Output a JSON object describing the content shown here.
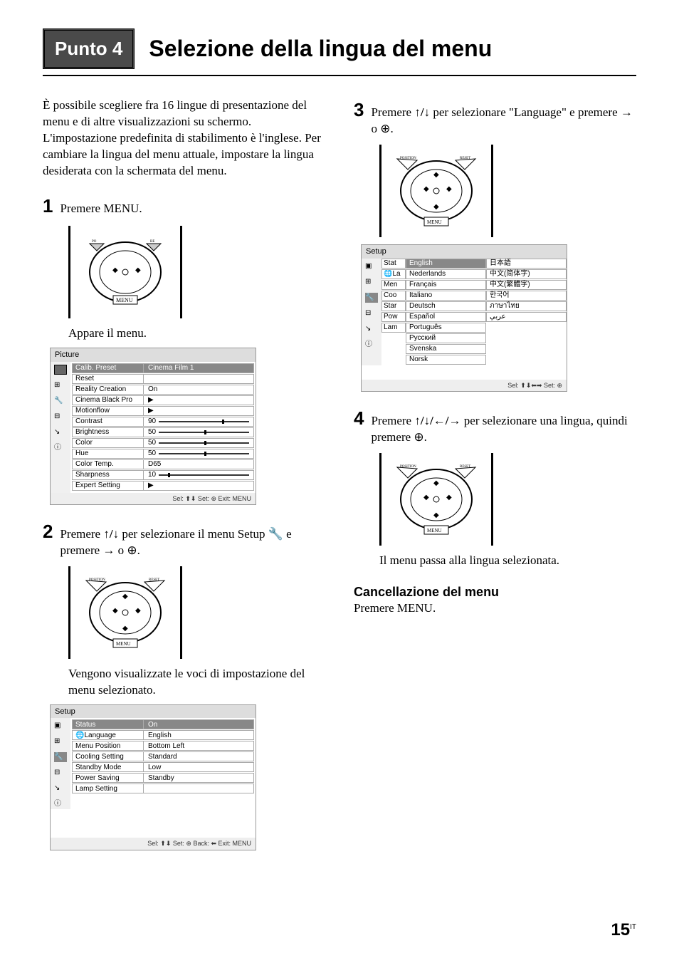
{
  "header": {
    "punto": "Punto 4",
    "title": "Selezione della lingua del menu"
  },
  "intro": "È possibile scegliere fra 16 lingue di presentazione del menu e di altre visualizzazioni su schermo. L'impostazione predefinita di stabilimento è l'inglese. Per cambiare la lingua del menu attuale, impostare la lingua desiderata con la schermata del menu.",
  "step1": {
    "num": "1",
    "text": "Premere MENU.",
    "caption": "Appare il menu."
  },
  "picture_menu": {
    "title": "Picture",
    "rows": [
      {
        "label": "Calib. Preset",
        "value": "Cinema Film 1"
      },
      {
        "label": "Reset",
        "value": ""
      },
      {
        "label": "Reality Creation",
        "value": "On"
      },
      {
        "label": "Cinema Black Pro",
        "value": "▶"
      },
      {
        "label": "Motionflow",
        "value": "▶"
      },
      {
        "label": "Contrast",
        "value": "90",
        "slider": 70
      },
      {
        "label": "Brightness",
        "value": "50",
        "slider": 50
      },
      {
        "label": "Color",
        "value": "50",
        "slider": 50
      },
      {
        "label": "Hue",
        "value": "50",
        "slider": 50
      },
      {
        "label": "Color Temp.",
        "value": "D65"
      },
      {
        "label": "Sharpness",
        "value": "10",
        "slider": 10
      },
      {
        "label": "Expert Setting",
        "value": "▶"
      }
    ],
    "footer": "Sel: ⬆⬇  Set: ⊕  Exit: MENU"
  },
  "step2": {
    "num": "2",
    "text_a": "Premere ",
    "text_b": " per selezionare il menu Setup ",
    "text_c": " e premere ",
    "text_d": " o ",
    "text_e": ".",
    "arrows_ud": "↑/↓",
    "arrow_r": "→",
    "caption": "Vengono visualizzate le voci di impostazione del menu selezionato."
  },
  "setup_menu": {
    "title": "Setup",
    "rows": [
      {
        "label": "Status",
        "value": "On",
        "sel": true
      },
      {
        "label": "🌐Language",
        "value": "English"
      },
      {
        "label": "Menu Position",
        "value": "Bottom Left"
      },
      {
        "label": "Cooling Setting",
        "value": "Standard"
      },
      {
        "label": "Standby Mode",
        "value": "Low"
      },
      {
        "label": "Power Saving",
        "value": "Standby"
      },
      {
        "label": "Lamp Setting",
        "value": ""
      }
    ],
    "footer": "Sel: ⬆⬇  Set: ⊕  Back: ⬅  Exit: MENU"
  },
  "step3": {
    "num": "3",
    "text_a": "Premere ",
    "text_b": " per selezionare \"Language\" e premere ",
    "text_c": " o ",
    "text_d": ".",
    "arrows_ud": "↑/↓",
    "arrow_r": "→"
  },
  "lang_menu": {
    "title": "Setup",
    "partial": [
      "Stat",
      "🌐La",
      "Men",
      "Coo",
      "Star",
      "Pow",
      "Lam"
    ],
    "left": [
      "English",
      "Nederlands",
      "Français",
      "Italiano",
      "Deutsch",
      "Español",
      "Português",
      "Русский",
      "Svenska",
      "Norsk"
    ],
    "right": [
      "日本語",
      "中文(简体字)",
      "中文(繁體字)",
      "한국어",
      "ภาษาไทย",
      "عربي"
    ],
    "footer": "Sel: ⬆⬇⬅➡  Set: ⊕"
  },
  "step4": {
    "num": "4",
    "text_a": "Premere ",
    "text_b": " per selezionare una lingua, quindi premere ",
    "text_c": ".",
    "arrows": "↑/↓/←/→",
    "caption": "Il menu passa alla lingua selezionata."
  },
  "cancel": {
    "title": "Cancellazione del menu",
    "text": "Premere MENU."
  },
  "joystick_labels": {
    "position": "POSITION",
    "reset": "RESET",
    "menu": "MENU"
  },
  "page": {
    "num": "15",
    "suffix": "IT"
  }
}
